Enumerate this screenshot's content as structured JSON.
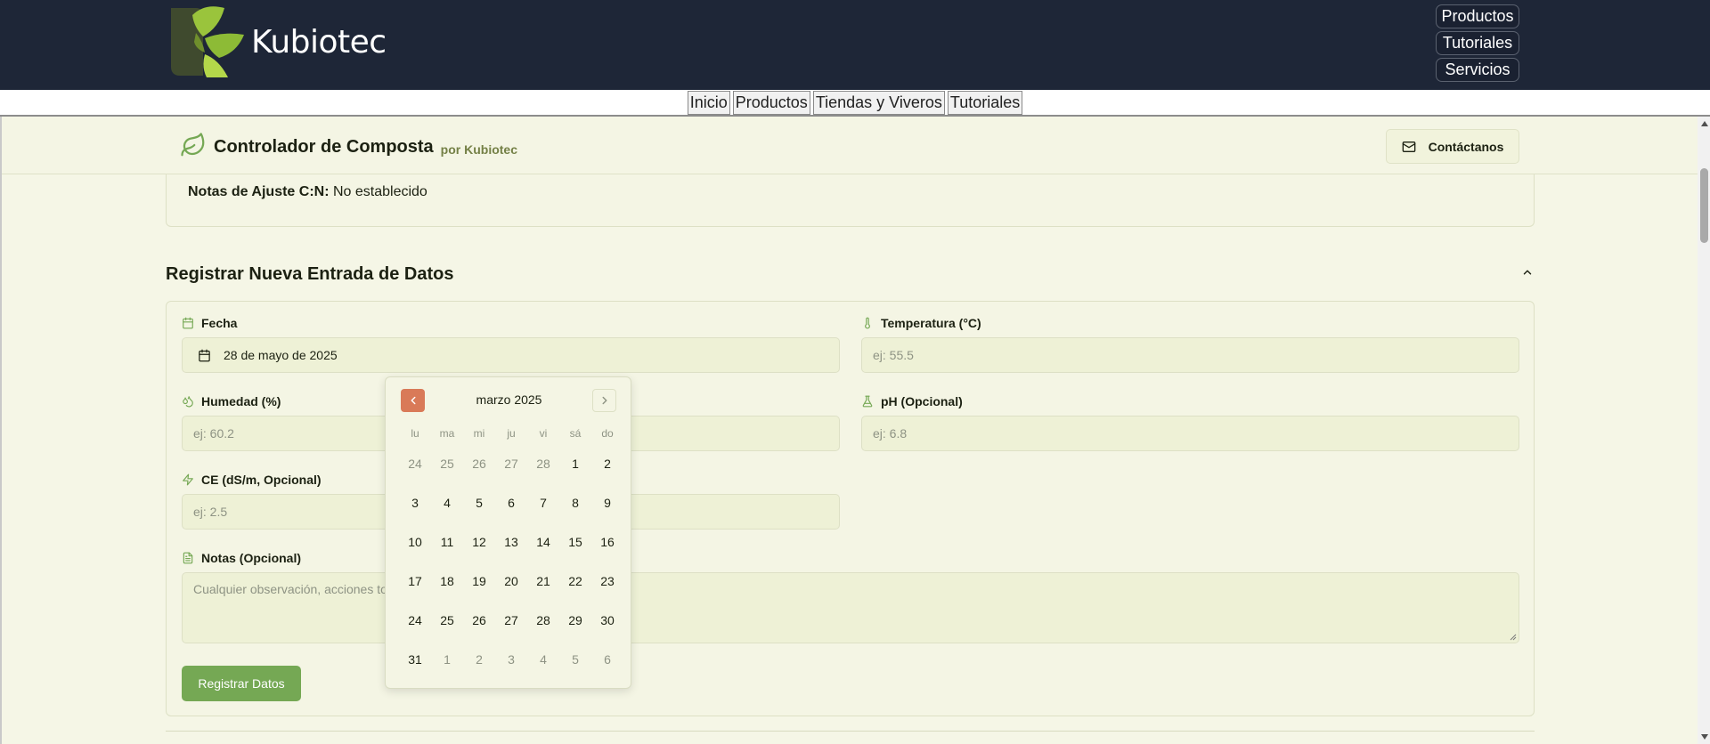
{
  "site": {
    "brand": "Kubiotec",
    "top_nav": [
      "Productos",
      "Tutoriales",
      "Servicios"
    ],
    "secondary_nav": [
      "Inicio",
      "Productos",
      "Tiendas y Viveros",
      "Tutoriales"
    ]
  },
  "app": {
    "title": "Controlador de Composta",
    "subtitle": "por Kubiotec",
    "contact_label": "Contáctanos"
  },
  "cn_notes": {
    "label": "Notas de Ajuste C:N:",
    "value": "No establecido"
  },
  "form": {
    "section_title": "Registrar Nueva Entrada de Datos",
    "fecha": {
      "label": "Fecha",
      "value": "28 de mayo de 2025"
    },
    "temperatura": {
      "label": "Temperatura (°C)",
      "placeholder": "ej: 55.5"
    },
    "humedad": {
      "label": "Humedad (%)",
      "placeholder": "ej: 60.2"
    },
    "ph": {
      "label": "pH (Opcional)",
      "placeholder": "ej: 6.8"
    },
    "ce": {
      "label": "CE (dS/m, Opcional)",
      "placeholder": "ej: 2.5"
    },
    "notas": {
      "label": "Notas (Opcional)",
      "placeholder": "Cualquier observación, acciones to"
    },
    "submit_label": "Registrar Datos"
  },
  "calendar": {
    "month_label": "marzo 2025",
    "weekdays": [
      "lu",
      "ma",
      "mi",
      "ju",
      "vi",
      "sá",
      "do"
    ],
    "weeks": [
      [
        {
          "d": "24",
          "out": true
        },
        {
          "d": "25",
          "out": true
        },
        {
          "d": "26",
          "out": true
        },
        {
          "d": "27",
          "out": true
        },
        {
          "d": "28",
          "out": true
        },
        {
          "d": "1",
          "out": false
        },
        {
          "d": "2",
          "out": false
        }
      ],
      [
        {
          "d": "3",
          "out": false
        },
        {
          "d": "4",
          "out": false
        },
        {
          "d": "5",
          "out": false
        },
        {
          "d": "6",
          "out": false
        },
        {
          "d": "7",
          "out": false
        },
        {
          "d": "8",
          "out": false
        },
        {
          "d": "9",
          "out": false
        }
      ],
      [
        {
          "d": "10",
          "out": false
        },
        {
          "d": "11",
          "out": false
        },
        {
          "d": "12",
          "out": false
        },
        {
          "d": "13",
          "out": false
        },
        {
          "d": "14",
          "out": false
        },
        {
          "d": "15",
          "out": false
        },
        {
          "d": "16",
          "out": false
        }
      ],
      [
        {
          "d": "17",
          "out": false
        },
        {
          "d": "18",
          "out": false
        },
        {
          "d": "19",
          "out": false
        },
        {
          "d": "20",
          "out": false
        },
        {
          "d": "21",
          "out": false
        },
        {
          "d": "22",
          "out": false
        },
        {
          "d": "23",
          "out": false
        }
      ],
      [
        {
          "d": "24",
          "out": false
        },
        {
          "d": "25",
          "out": false
        },
        {
          "d": "26",
          "out": false
        },
        {
          "d": "27",
          "out": false
        },
        {
          "d": "28",
          "out": false
        },
        {
          "d": "29",
          "out": false
        },
        {
          "d": "30",
          "out": false
        }
      ],
      [
        {
          "d": "31",
          "out": false
        },
        {
          "d": "1",
          "out": true
        },
        {
          "d": "2",
          "out": true
        },
        {
          "d": "3",
          "out": true
        },
        {
          "d": "4",
          "out": true
        },
        {
          "d": "5",
          "out": true
        },
        {
          "d": "6",
          "out": true
        }
      ]
    ]
  },
  "colors": {
    "header_bg": "#1e2637",
    "page_bg": "#f5f6e6",
    "accent_green": "#75a854",
    "prev_month_btn": "#d97a58"
  }
}
